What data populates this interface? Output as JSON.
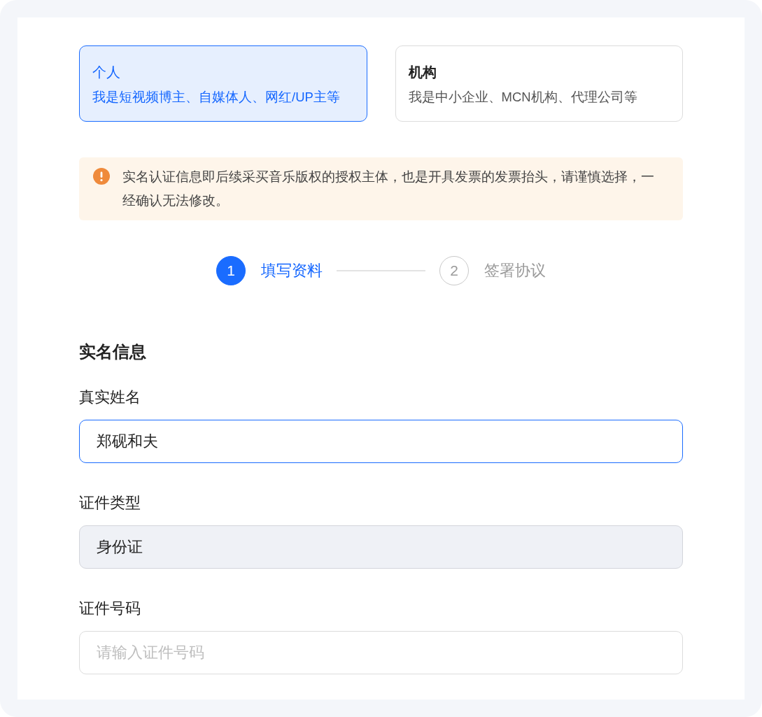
{
  "account_types": [
    {
      "title": "个人",
      "description": "我是短视频博主、自媒体人、网红/UP主等",
      "selected": true
    },
    {
      "title": "机构",
      "description": "我是中小企业、MCN机构、代理公司等",
      "selected": false
    }
  ],
  "notice": {
    "text": "实名认证信息即后续采买音乐版权的授权主体，也是开具发票的发票抬头，请谨慎选择，一经确认无法修改。"
  },
  "steps": [
    {
      "number": "1",
      "label": "填写资料",
      "active": true
    },
    {
      "number": "2",
      "label": "签署协议",
      "active": false
    }
  ],
  "section": {
    "title": "实名信息",
    "fields": [
      {
        "label": "真实姓名",
        "value": "郑砚和夫",
        "focused": true,
        "disabled": false
      },
      {
        "label": "证件类型",
        "value": "身份证",
        "focused": false,
        "disabled": true
      },
      {
        "label": "证件号码",
        "placeholder": "请输入证件号码",
        "focused": false,
        "disabled": false
      }
    ]
  }
}
